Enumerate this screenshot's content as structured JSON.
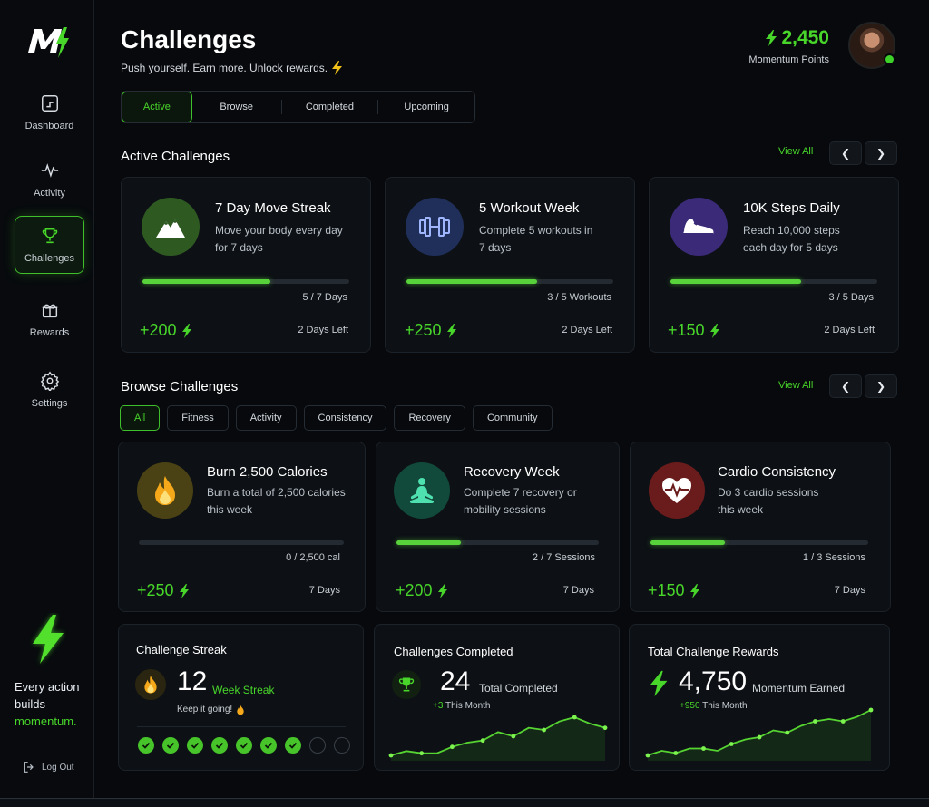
{
  "sidebar": {
    "items": [
      {
        "label": "Dashboard",
        "icon": "dashboard-icon"
      },
      {
        "label": "Activity",
        "icon": "pulse-icon"
      },
      {
        "label": "Challenges",
        "icon": "trophy-icon",
        "active": true
      },
      {
        "label": "Rewards",
        "icon": "gift-icon"
      },
      {
        "label": "Settings",
        "icon": "gear-icon"
      }
    ],
    "tagline_line1": "Every action",
    "tagline_line2": "builds",
    "tagline_accent": "momentum.",
    "logout_label": "Log Out"
  },
  "header": {
    "title": "Challenges",
    "subtitle": "Push yourself. Earn more. Unlock rewards.",
    "points_value": "2,450",
    "points_label": "Momentum Points"
  },
  "tabs": [
    "Active",
    "Browse",
    "Completed",
    "Upcoming"
  ],
  "active_section": {
    "title": "Active Challenges",
    "view_all": "View All",
    "cards": [
      {
        "title": "7 Day Move Streak",
        "desc1": "Move your body every day",
        "desc2": "for 7 days",
        "progress_text": "5 / 7 Days",
        "progress": 0.62,
        "reward": "+200",
        "time_left": "2 Days Left",
        "icon": "mountain-icon",
        "color": "#2e5a22"
      },
      {
        "title": "5 Workout Week",
        "desc1": "Complete 5 workouts in",
        "desc2": "7 days",
        "progress_text": "3 / 5 Workouts",
        "progress": 0.63,
        "reward": "+250",
        "time_left": "2 Days Left",
        "icon": "dumbbell-icon",
        "color": "#1f2f5a"
      },
      {
        "title": "10K Steps Daily",
        "desc1": "Reach 10,000 steps",
        "desc2": "each day for 5 days",
        "progress_text": "3 / 5 Days",
        "progress": 0.63,
        "reward": "+150",
        "time_left": "2 Days Left",
        "icon": "shoe-icon",
        "color": "#3a2a78"
      }
    ]
  },
  "browse_section": {
    "title": "Browse Challenges",
    "view_all": "View All",
    "chips": [
      "All",
      "Fitness",
      "Activity",
      "Consistency",
      "Recovery",
      "Community"
    ],
    "cards": [
      {
        "title": "Burn 2,500 Calories",
        "desc1": "Burn a total of 2,500 calories",
        "desc2": "this week",
        "progress_text": "0 / 2,500 cal",
        "progress": 0,
        "reward": "+250",
        "duration": "7 Days",
        "icon": "flame-icon",
        "color": "#4a4214"
      },
      {
        "title": "Recovery Week",
        "desc1": "Complete 7 recovery or",
        "desc2": "mobility sessions",
        "progress_text": "2 / 7 Sessions",
        "progress": 0.32,
        "reward": "+200",
        "duration": "7 Days",
        "icon": "meditation-icon",
        "color": "#114a3a"
      },
      {
        "title": "Cardio Consistency",
        "desc1": "Do 3 cardio sessions",
        "desc2": "this week",
        "progress_text": "1 / 3 Sessions",
        "progress": 0.34,
        "reward": "+150",
        "duration": "7 Days",
        "icon": "heart-pulse-icon",
        "color": "#6a1c1c"
      }
    ]
  },
  "stats": {
    "streak": {
      "title": "Challenge Streak",
      "value": "12",
      "label": "Week Streak",
      "note": "Keep it going!",
      "checks_done": 7,
      "checks_total": 9
    },
    "completed": {
      "title": "Challenges Completed",
      "value": "24",
      "label": "Total Completed",
      "delta": "+3",
      "delta_label": "This Month",
      "trend": [
        2,
        4,
        3,
        3,
        6,
        8,
        9,
        13,
        11,
        15,
        14,
        18,
        20,
        17,
        15
      ]
    },
    "rewards": {
      "title": "Total Challenge Rewards",
      "value": "4,750",
      "label": "Momentum Earned",
      "delta": "+950",
      "delta_label": "This Month",
      "trend": [
        2,
        4,
        3,
        5,
        5,
        4,
        7,
        9,
        10,
        13,
        12,
        15,
        17,
        18,
        17,
        19,
        22
      ]
    }
  },
  "colors": {
    "accent": "#48d62a",
    "background": "#07090c",
    "card": "#0d1115"
  }
}
